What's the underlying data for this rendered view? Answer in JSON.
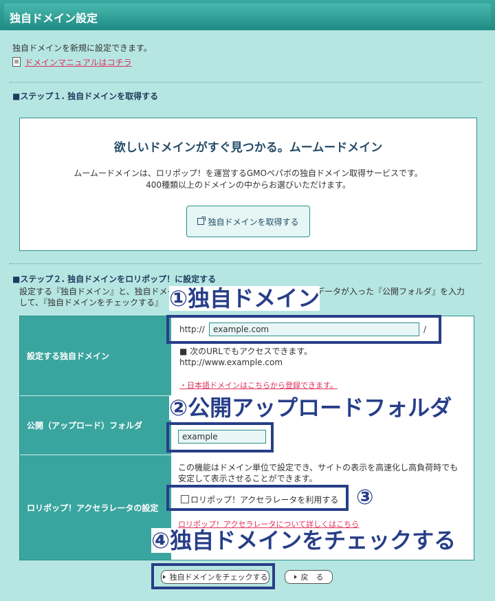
{
  "header": {
    "title": "独自ドメイン設定"
  },
  "intro": {
    "text": "独自ドメインを新規に設定できます。",
    "manual_link": "ドメインマニュアルはコチラ"
  },
  "step1": {
    "heading": "■ステップ１. 独自ドメインを取得する",
    "promo_title": "欲しいドメインがすぐ見つかる。ムームードメイン",
    "promo_line1": "ムームードメインは、ロリポップ！を運営するGMOペパボの独自ドメイン取得サービスです。",
    "promo_line2": "400種類以上のドメインの中からお選びいただけます。",
    "button": "独自ドメインを取得する"
  },
  "step2": {
    "heading": "■ステップ２. 独自ドメインをロリポップ！に設定する",
    "desc_line1": "設定する『独自ドメイン』と、独自ドメイ",
    "desc_line1_end": "データが入った『公開フォルダ』を入力",
    "desc_line2": "して、『独自ドメインをチェックする』",
    "rows": {
      "domain": {
        "label": "設定する独自ドメイン",
        "prefix": "http://",
        "value": "example.com",
        "suffix": "/",
        "note": "■ 次のURLでもアクセスできます。",
        "url": "http://www.example.com",
        "jp_link": "・日本語ドメインはこちらから登録できます。"
      },
      "folder": {
        "label": "公開（アップロード）フォルダ",
        "value": "example"
      },
      "accel": {
        "label": "ロリポップ！アクセラレータの設定",
        "desc1": "この機能はドメイン単位で設定でき、サイトの表示を高速化し高負荷時でも",
        "desc2": "安定して表示させることができます。",
        "checkbox_label": "ロリポップ！アクセラレータを利用する",
        "detail_link": "ロリポップ！アクセラレータについて詳しくはこちら"
      }
    }
  },
  "buttons": {
    "check": "独自ドメインをチェックする",
    "back": "戻　る"
  },
  "annotations": {
    "a1": "①独自ドメイン",
    "a2": "②公開アップロードフォルダ",
    "a3": "③",
    "a4": "④独自ドメインをチェックする"
  },
  "colors": {
    "bg": "#b6e6e2",
    "teal": "#3aa59f",
    "annotation": "#273e88",
    "link": "#e0305c"
  }
}
